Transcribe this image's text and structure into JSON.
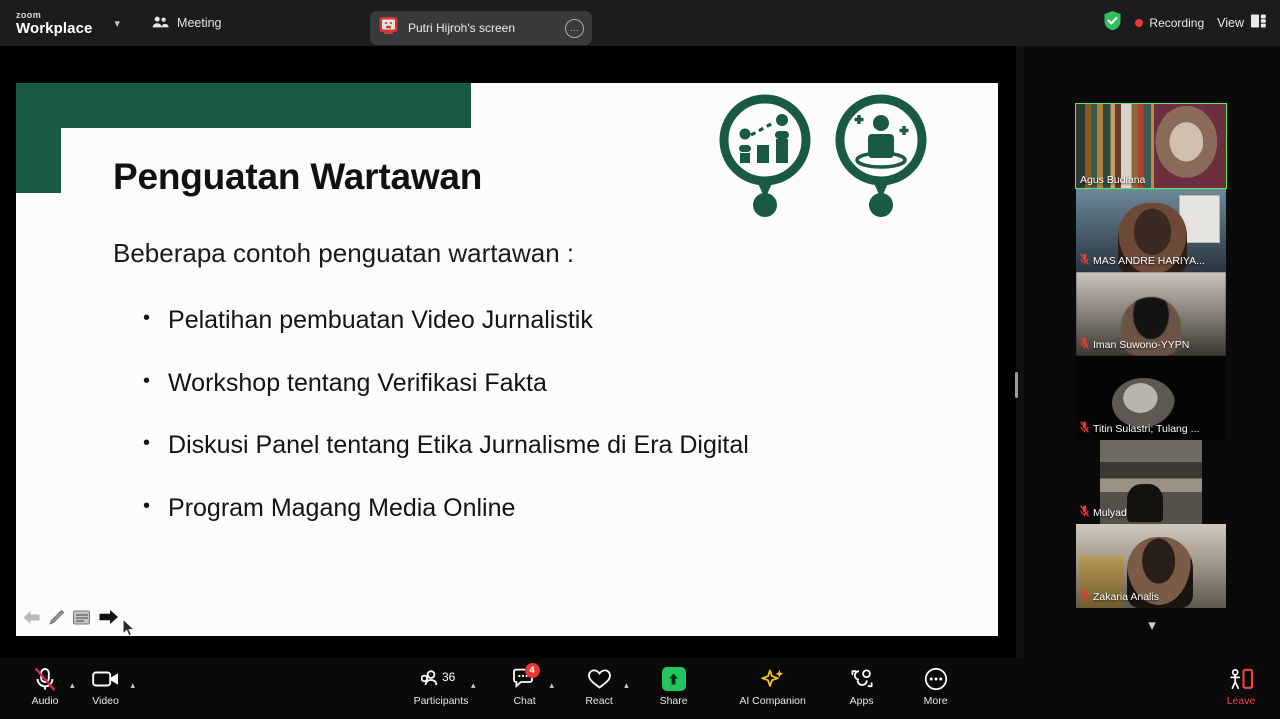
{
  "app": {
    "brand_small": "zoom",
    "brand_main": "Workplace",
    "meeting_label": "Meeting"
  },
  "topbar": {
    "share_indicator": "Putri Hijroh's screen",
    "recording_label": "Recording",
    "view_label": "View",
    "icons": {
      "brand_caret": "chevron-down-icon",
      "meeting": "people-icon",
      "share_source": "screen-share-icon",
      "share_more": "more-options-icon",
      "encryption": "green-shield-icon",
      "recording": "recording-dot-icon",
      "view_layout": "layout-grid-icon"
    }
  },
  "slide": {
    "title": "Penguatan Wartawan",
    "lead": "Beberapa contoh penguatan wartawan :",
    "bullets": [
      "Pelatihan pembuatan Video Jurnalistik",
      "Workshop tentang Verifikasi Fakta",
      "Diskusi Panel tentang Etika Jurnalisme di Era Digital",
      "Program Magang Media Online"
    ],
    "bullet_marker": "•",
    "accent_color": "#1a5a44",
    "background_color": "#fdfcfd",
    "decorative_icons": [
      "growth-chart-magnifier-icon",
      "person-sparkle-magnifier-icon"
    ],
    "nav": {
      "previous": "previous-slide-arrow",
      "pen": "annotation-pen-icon",
      "menu": "slide-menu-icon",
      "next": "next-slide-arrow"
    }
  },
  "filmstrip": {
    "scroll_down": "chevron-down-icon",
    "participants": [
      {
        "name": "Agus Budiana",
        "muted": false,
        "active_speaker": true,
        "art": "art-books"
      },
      {
        "name": "MAS ANDRE HARIYA...",
        "muted": true,
        "active_speaker": false,
        "art": "art-andre"
      },
      {
        "name": "Iman Suwono-YYPN",
        "muted": true,
        "active_speaker": false,
        "art": "art-iman"
      },
      {
        "name": "Titin Sulastri; Tulang ...",
        "muted": true,
        "active_speaker": false,
        "art": "art-titin"
      },
      {
        "name": "Mulyadi",
        "muted": true,
        "active_speaker": false,
        "art": "art-mulyadi"
      },
      {
        "name": "Zakaria Analis",
        "muted": true,
        "active_speaker": false,
        "art": "art-zakaria"
      }
    ]
  },
  "toolbar": {
    "audio_label": "Audio",
    "video_label": "Video",
    "participants_label": "Participants",
    "participants_count": "36",
    "chat_label": "Chat",
    "chat_badge": "4",
    "react_label": "React",
    "share_label": "Share",
    "ai_companion_label": "AI Companion",
    "apps_label": "Apps",
    "more_label": "More",
    "leave_label": "Leave",
    "icons": {
      "audio": "microphone-muted-icon",
      "video": "camera-icon",
      "participants": "people-icon",
      "chat": "chat-bubble-icon",
      "react": "heart-icon",
      "share": "share-screen-up-arrow-icon",
      "ai_companion": "sparkle-icon",
      "apps": "apps-icon",
      "more": "ellipsis-circle-icon",
      "leave": "leave-door-icon"
    },
    "accent_share": "#23c55e",
    "accent_leave": "#ef4444",
    "accent_badge": "#e8392f",
    "accent_ai": "#f5c518"
  }
}
